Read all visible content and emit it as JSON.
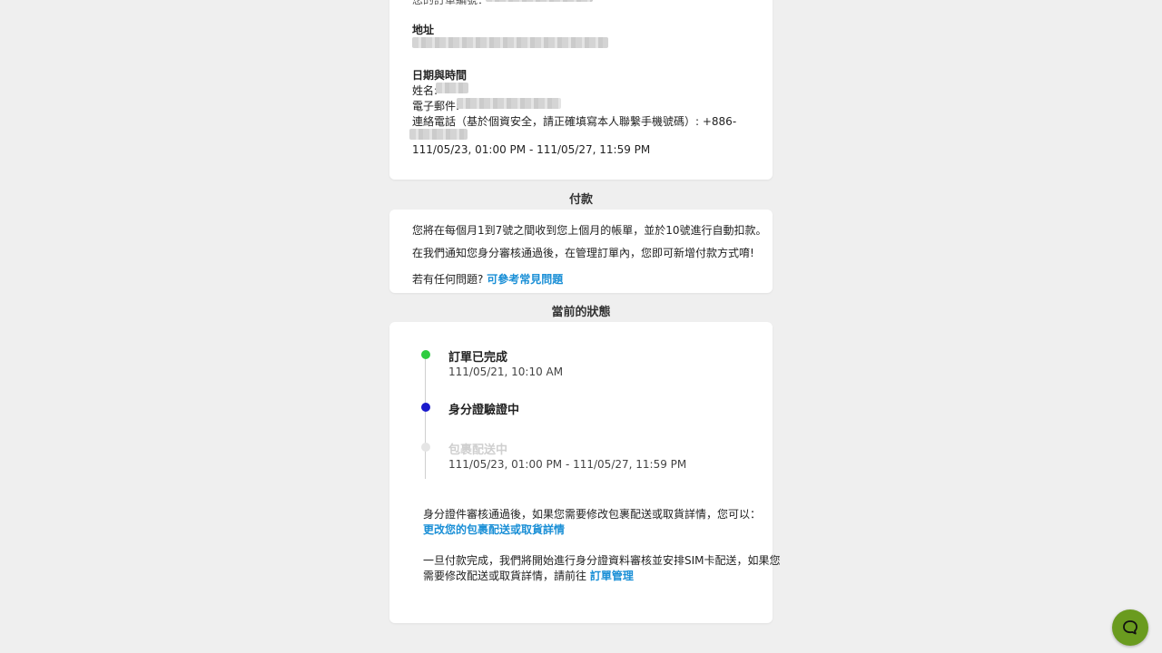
{
  "top_card": {
    "order_number_label": "您的訂單編號：",
    "address_label": "地址",
    "datetime_label": "日期與時間",
    "name_label": "姓名:",
    "email_label": "電子郵件:",
    "phone_label": "連絡電話（基於個資安全，請正確填寫本人聯繫手機號碼）: +886-",
    "date_range": "111/05/23, 01:00 PM - 111/05/27, 11:59 PM"
  },
  "payment": {
    "section_title": "付款",
    "line1": "您將在每個月1到7號之間收到您上個月的帳單，並於10號進行自動扣款。",
    "line2": "在我們通知您身分審核通過後，在管理訂單內，您即可新增付款方式唷!",
    "faq_prefix": "若有任何問題?",
    "faq_link": "可參考常見問題"
  },
  "status": {
    "section_title": "當前的狀態",
    "timeline": [
      {
        "title": "訂單已完成",
        "subtitle": "111/05/21, 10:10 AM",
        "color": "#2ecc40"
      },
      {
        "title": "身分證驗證中",
        "subtitle": "",
        "color": "#1a1acc"
      },
      {
        "title": "包裹配送中",
        "subtitle": "111/05/23, 01:00 PM - 111/05/27, 11:59 PM",
        "color": "#e5e5e5"
      }
    ],
    "note1_text": "身分證件審核通過後，如果您需要修改包裹配送或取貨詳情，您可以：",
    "note1_link": "更改您的包裹配送或取貨詳情",
    "note2_line1": "一旦付款完成，我們將開始進行身分證資料審核並安排SIM卡配送，如果您",
    "note2_line2_prefix": "需要修改配送或取貨詳情，請前往",
    "note2_link": "訂單管理"
  },
  "colors": {
    "link": "#1a8fd6",
    "chat_button": "#6a9b1f",
    "background": "#efefef"
  },
  "icons": {
    "chat": "chat-bubble-icon"
  }
}
